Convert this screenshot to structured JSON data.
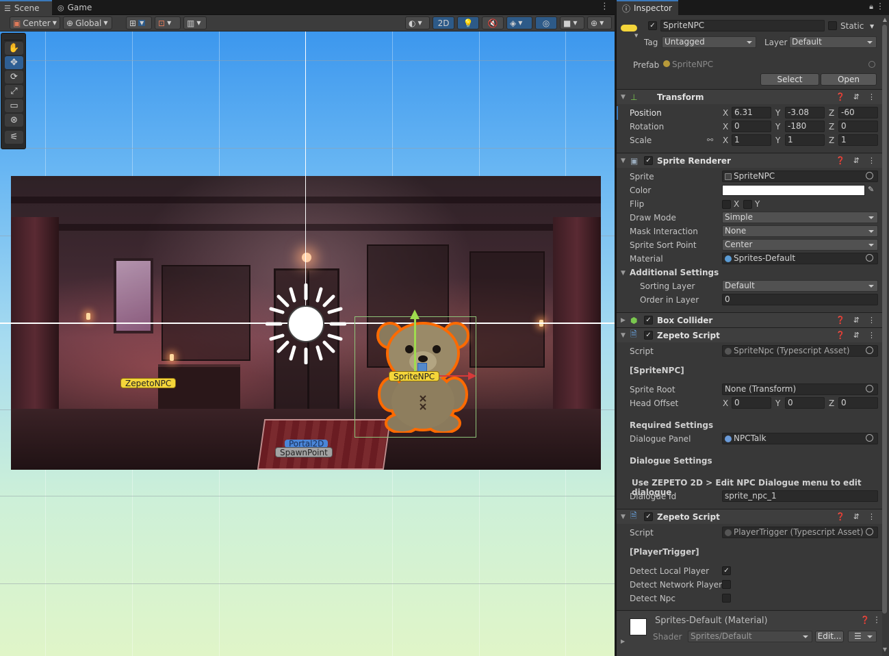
{
  "scene_tabs": {
    "scene": "Scene",
    "game": "Game"
  },
  "scene_toolbar": {
    "pivot": "Center",
    "space": "Global",
    "mode_2d": "2D"
  },
  "scene_labels": {
    "zepeto_npc": "ZepetoNPC",
    "sprite_npc": "SpriteNPC",
    "portal": "Portal2D",
    "spawn": "SpawnPoint"
  },
  "inspector": {
    "tab": "Inspector",
    "object_name": "SpriteNPC",
    "static_label": "Static",
    "tag_label": "Tag",
    "tag_value": "Untagged",
    "layer_label": "Layer",
    "layer_value": "Default",
    "prefab_label": "Prefab",
    "prefab_value": "SpriteNPC",
    "select_btn": "Select",
    "open_btn": "Open",
    "transform": {
      "title": "Transform",
      "position_label": "Position",
      "rotation_label": "Rotation",
      "scale_label": "Scale",
      "position": {
        "x": "6.31",
        "y": "-3.08",
        "z": "-60"
      },
      "rotation": {
        "x": "0",
        "y": "-180",
        "z": "0"
      },
      "scale": {
        "x": "1",
        "y": "1",
        "z": "1"
      },
      "axes": {
        "x": "X",
        "y": "Y",
        "z": "Z"
      }
    },
    "sprite_renderer": {
      "title": "Sprite Renderer",
      "sprite_label": "Sprite",
      "sprite_value": "SpriteNPC",
      "color_label": "Color",
      "flip_label": "Flip",
      "flip_x": "X",
      "flip_y": "Y",
      "draw_mode_label": "Draw Mode",
      "draw_mode": "Simple",
      "mask_label": "Mask Interaction",
      "mask": "None",
      "sort_point_label": "Sprite Sort Point",
      "sort_point": "Center",
      "material_label": "Material",
      "material": "Sprites-Default",
      "additional_label": "Additional Settings",
      "sorting_layer_label": "Sorting Layer",
      "sorting_layer": "Default",
      "order_label": "Order in Layer",
      "order": "0"
    },
    "box_collider": {
      "title": "Box Collider"
    },
    "zepeto_script_1": {
      "title": "Zepeto Script",
      "script_label": "Script",
      "script": "SpriteNpc (Typescript Asset)",
      "class_label": "[SpriteNPC]",
      "sprite_root_label": "Sprite Root",
      "sprite_root": "None (Transform)",
      "head_offset_label": "Head Offset",
      "head_offset": {
        "x": "0",
        "y": "0",
        "z": "0"
      },
      "required_label": "Required Settings",
      "dialogue_panel_label": "Dialogue Panel",
      "dialogue_panel": "NPCTalk",
      "dialogue_settings_label": "Dialogue Settings",
      "help_text": "Use ZEPETO 2D > Edit NPC Dialogue menu to edit dialogue",
      "dialogue_id_label": "Dialogue Id",
      "dialogue_id": "sprite_npc_1"
    },
    "zepeto_script_2": {
      "title": "Zepeto Script",
      "script_label": "Script",
      "script": "PlayerTrigger (Typescript Asset)",
      "class_label": "[PlayerTrigger]",
      "local_label": "Detect Local Player",
      "local": true,
      "network_label": "Detect Network Player",
      "network": false,
      "npc_label": "Detect Npc",
      "npc": false
    },
    "material_footer": {
      "title": "Sprites-Default (Material)",
      "shader_label": "Shader",
      "shader": "Sprites/Default",
      "edit_btn": "Edit..."
    }
  },
  "colors": {
    "accent": "#3a79bb",
    "selection_orange": "#ff6a00",
    "gizmo_green": "#9fdc4e",
    "gizmo_red": "#d73a3a"
  }
}
